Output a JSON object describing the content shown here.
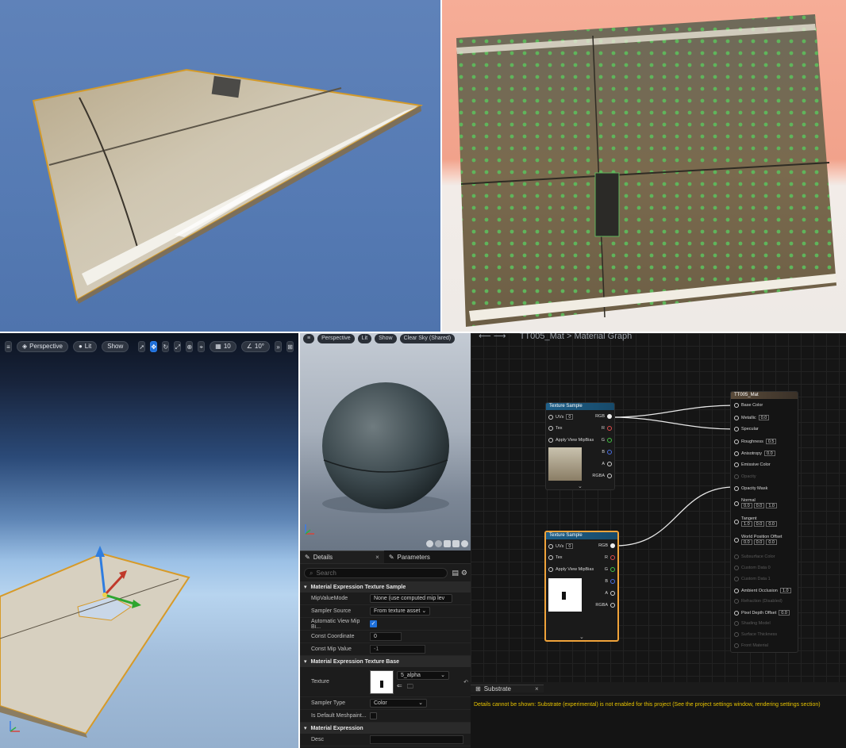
{
  "viewport_bl": {
    "toolbar": {
      "menu_icon": "hamburger-icon",
      "perspective_label": "Perspective",
      "lit_label": "Lit",
      "show_label": "Show",
      "grid_snap_value": "10",
      "rotation_snap_value": "10°"
    }
  },
  "preview": {
    "toolbar": {
      "perspective_label": "Perspective",
      "lit_label": "Lit",
      "show_label": "Show",
      "sky_label": "Clear Sky (Shared)"
    }
  },
  "details": {
    "tab_details": "Details",
    "tab_parameters": "Parameters",
    "search_placeholder": "Search",
    "sections": [
      {
        "title": "Material Expression Texture Sample",
        "rows": [
          {
            "label": "MipValueMode",
            "value": "None (use computed mip lev"
          },
          {
            "label": "Sampler Source",
            "value": "From texture asset"
          },
          {
            "label": "Automatic View Mip Bi...",
            "value": "checked"
          },
          {
            "label": "Const Coordinate",
            "value": "0"
          },
          {
            "label": "Const Mip Value",
            "value": "-1"
          }
        ]
      },
      {
        "title": "Material Expression Texture Base",
        "rows": [
          {
            "label": "Texture",
            "value": "5_alpha"
          },
          {
            "label": "Sampler Type",
            "value": "Color"
          },
          {
            "label": "Is Default Meshpaint...",
            "value": "unchecked"
          }
        ]
      },
      {
        "title": "Material Expression",
        "rows": [
          {
            "label": "Desc",
            "value": ""
          }
        ]
      }
    ]
  },
  "graph": {
    "breadcrumb": "TT005_Mat > Material Graph",
    "node1": {
      "title": "Texture Sample",
      "inputs": [
        "UVs",
        "Tex",
        "Apply View MipBias"
      ],
      "uvs_value": "0",
      "outputs": [
        "RGB",
        "R",
        "G",
        "B",
        "A",
        "RGBA"
      ]
    },
    "node2": {
      "title": "Texture Sample",
      "inputs": [
        "UVs",
        "Tex",
        "Apply View MipBias"
      ],
      "uvs_value": "0",
      "outputs": [
        "RGB",
        "R",
        "G",
        "B",
        "A",
        "RGBA"
      ]
    },
    "result": {
      "title": "TT005_Mat",
      "pins": [
        {
          "label": "Base Color",
          "value": ""
        },
        {
          "label": "Metallic",
          "value": "0.0"
        },
        {
          "label": "Specular",
          "value": ""
        },
        {
          "label": "Roughness",
          "value": "0.5"
        },
        {
          "label": "Anisotropy",
          "value": "0.0"
        },
        {
          "label": "Emissive Color",
          "value": ""
        },
        {
          "label": "Opacity",
          "value": ""
        },
        {
          "label": "Opacity Mask",
          "value": ""
        }
      ],
      "normal": {
        "label": "Normal",
        "x": "0.0",
        "y": "0.0",
        "z": "1.0"
      },
      "tangent": {
        "label": "Tangent",
        "x": "1.0",
        "y": "0.0",
        "z": "0.0"
      },
      "wpo": {
        "label": "World Position Offset",
        "x": "0.0",
        "y": "0.0",
        "z": "0.0"
      },
      "pins2": [
        {
          "label": "Subsurface Color",
          "value": ""
        },
        {
          "label": "Custom Data 0",
          "value": ""
        },
        {
          "label": "Custom Data 1",
          "value": ""
        },
        {
          "label": "Ambient Occlusion",
          "value": "1.0"
        },
        {
          "label": "Refraction (Disabled)",
          "value": ""
        },
        {
          "label": "Pixel Depth Offset",
          "value": "0.0"
        },
        {
          "label": "Shading Model",
          "value": ""
        },
        {
          "label": "Surface Thickness",
          "value": ""
        },
        {
          "label": "Front Material",
          "value": ""
        }
      ]
    }
  },
  "substrate": {
    "tab": "Substrate",
    "message": "Details cannot be shown: Substrate (experimental) is not enabled for this project (See the project settings window, rendering settings section)"
  }
}
